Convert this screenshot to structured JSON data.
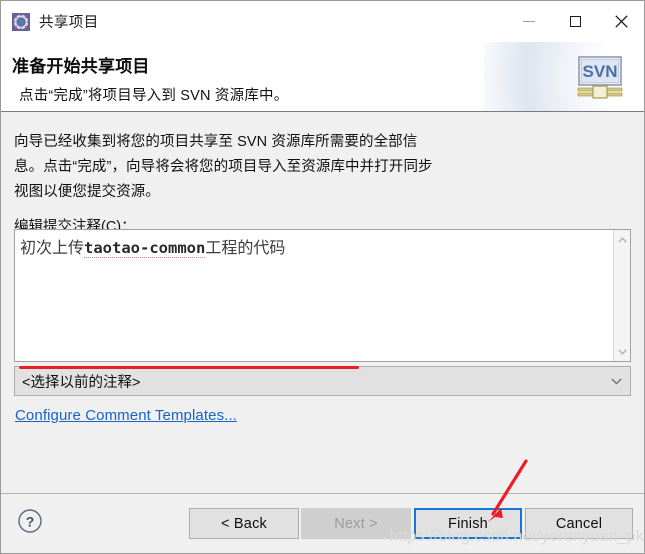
{
  "window": {
    "title": "共享项目",
    "icon": "gear-icon",
    "controls": {
      "minimize": "minimize-icon",
      "maximize": "maximize-icon",
      "close": "close-icon"
    }
  },
  "header": {
    "title": "准备开始共享项目",
    "subtitle": "点击“完成”将项目导入到 SVN 资源库中。",
    "logo_text": "SVN"
  },
  "main": {
    "description": "向导已经收集到将您的项目共享至 SVN 资源库所需要的全部信息。点击“完成”，向导将会将您的项目导入至资源库中并打开同步视图以便您提交资源。",
    "comment_label": "编辑提交注释(C)：",
    "comment_value_prefix": "初次上传",
    "comment_value_mono": "taotao-common",
    "comment_value_suffix": "工程的代码",
    "combo_value": "<选择以前的注释>",
    "combo_arrow_icon": "chevron-down-icon",
    "scroll_up_icon": "chevron-up-icon",
    "scroll_down_icon": "chevron-down-icon",
    "configure_link": "Configure Comment Templates..."
  },
  "footer": {
    "help_icon": "question-mark-icon",
    "back_label": "< Back",
    "next_label": "Next >",
    "finish_label": "Finish",
    "cancel_label": "Cancel"
  },
  "annotations": {
    "watermark": "https://blog.csdn.net/yerenyuan_pku",
    "underline_color": "#ec1c24",
    "arrow_color": "#ec1c24",
    "focus_color": "#1477d4"
  }
}
